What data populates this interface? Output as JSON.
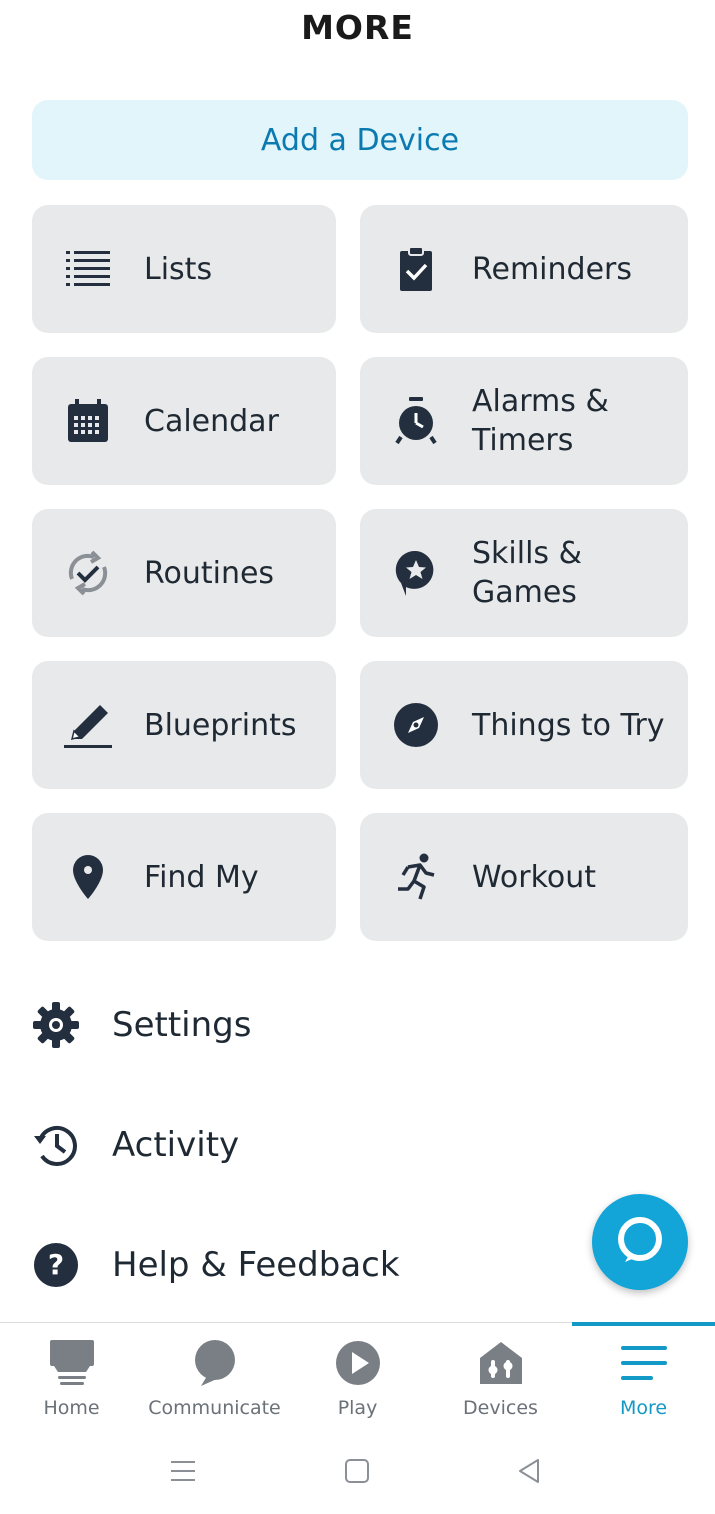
{
  "header": {
    "title": "MORE"
  },
  "add_device": {
    "label": "Add a Device"
  },
  "tiles": [
    {
      "label": "Lists",
      "icon": "list-icon"
    },
    {
      "label": "Reminders",
      "icon": "clipboard-check-icon"
    },
    {
      "label": "Calendar",
      "icon": "calendar-icon"
    },
    {
      "label": "Alarms &\nTimers",
      "icon": "alarm-clock-icon"
    },
    {
      "label": "Routines",
      "icon": "routine-cycle-icon"
    },
    {
      "label": "Skills &\nGames",
      "icon": "skills-star-icon"
    },
    {
      "label": "Blueprints",
      "icon": "pencil-icon"
    },
    {
      "label": "Things to Try",
      "icon": "compass-icon"
    },
    {
      "label": "Find My",
      "icon": "location-pin-icon"
    },
    {
      "label": "Workout",
      "icon": "running-icon"
    }
  ],
  "menu": [
    {
      "label": "Settings",
      "icon": "gear-icon"
    },
    {
      "label": "Activity",
      "icon": "history-icon"
    },
    {
      "label": "Help & Feedback",
      "icon": "help-icon"
    }
  ],
  "tabs": [
    {
      "label": "Home",
      "icon": "home-icon"
    },
    {
      "label": "Communicate",
      "icon": "speech-bubble-icon"
    },
    {
      "label": "Play",
      "icon": "play-icon"
    },
    {
      "label": "Devices",
      "icon": "devices-icon"
    },
    {
      "label": "More",
      "icon": "menu-icon",
      "active": true
    }
  ],
  "colors": {
    "accent": "#1399c6",
    "tile_bg": "#e8e9ea",
    "add_device_bg": "#e1f5fa",
    "alexa_blue": "#13a4d8"
  }
}
